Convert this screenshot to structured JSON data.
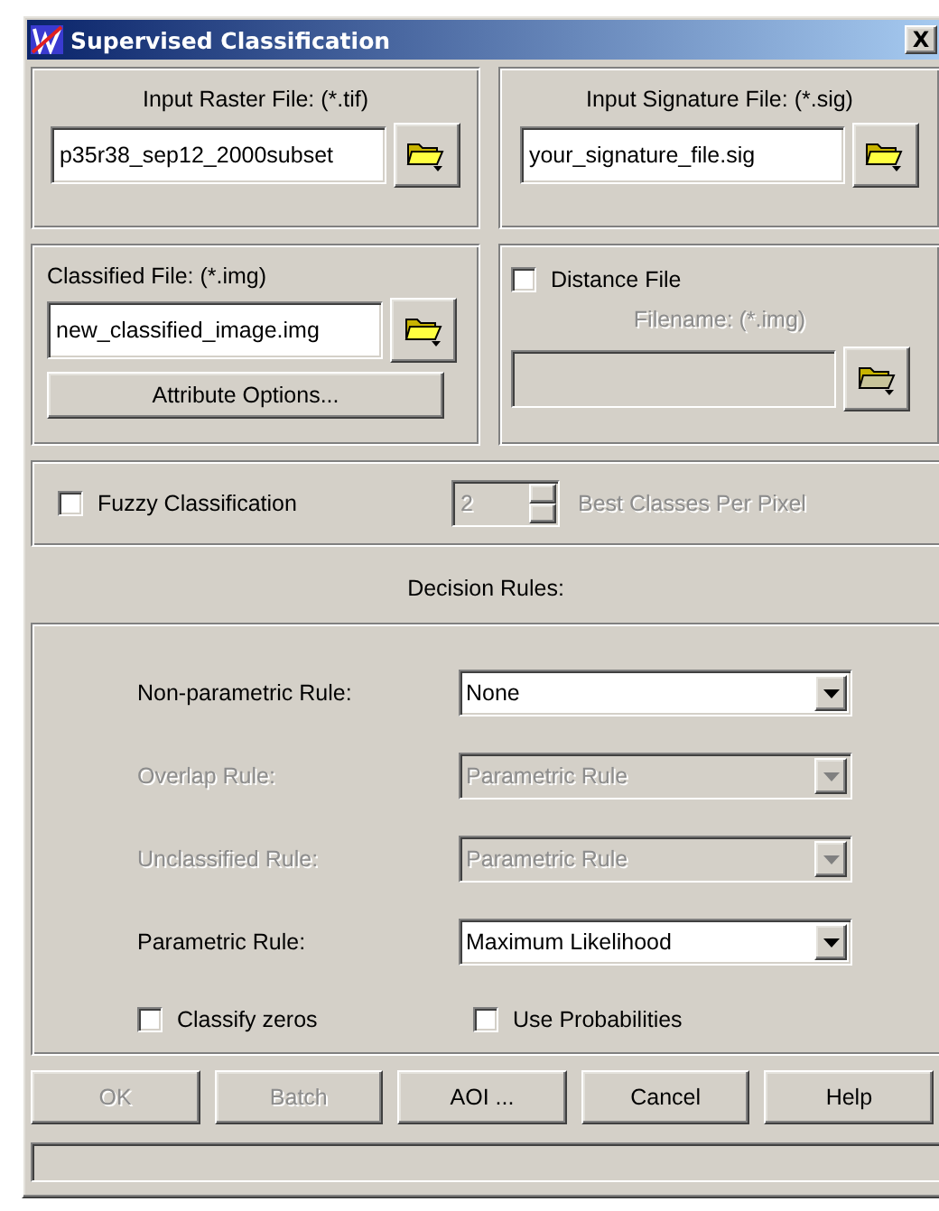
{
  "window": {
    "title": "Supervised Classification",
    "close": "X"
  },
  "input_raster": {
    "label": "Input Raster File: (*.tif)",
    "value": "p35r38_sep12_2000subset"
  },
  "input_signature": {
    "label": "Input Signature File: (*.sig)",
    "value": "your_signature_file.sig"
  },
  "classified": {
    "label": "Classified File: (*.img)",
    "value": "new_classified_image.img",
    "button": "Attribute Options..."
  },
  "distance_file": {
    "label": "Distance File",
    "checked": false,
    "filename_label": "Filename: (*.img)"
  },
  "fuzzy": {
    "label": "Fuzzy Classification",
    "checked": false,
    "count": "2",
    "suffix": "Best Classes Per Pixel"
  },
  "decision_rules": {
    "title": "Decision Rules:",
    "rules": [
      {
        "label": "Non-parametric Rule:",
        "value": "None",
        "disabled": false
      },
      {
        "label": "Overlap Rule:",
        "value": "Parametric Rule",
        "disabled": true
      },
      {
        "label": "Unclassified Rule:",
        "value": "Parametric Rule",
        "disabled": true
      },
      {
        "label": "Parametric Rule:",
        "value": "Maximum Likelihood",
        "disabled": false
      }
    ],
    "checkboxes": [
      {
        "label": "Classify zeros",
        "checked": false
      },
      {
        "label": "Use Probabilities",
        "checked": false
      }
    ]
  },
  "buttons": [
    {
      "label": "OK",
      "disabled": true
    },
    {
      "label": "Batch",
      "disabled": true
    },
    {
      "label": "AOI ...",
      "disabled": false
    },
    {
      "label": "Cancel",
      "disabled": false
    },
    {
      "label": "Help",
      "disabled": false
    }
  ]
}
